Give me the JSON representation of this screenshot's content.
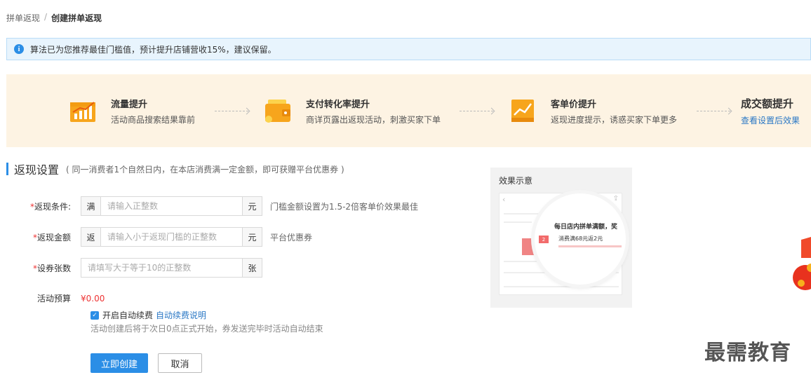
{
  "breadcrumb": {
    "parent": "拼单返现",
    "separator": "/",
    "current": "创建拼单返现"
  },
  "info": {
    "icon": "info-icon",
    "text": "算法已为您推荐最佳门槛值，预计提升店铺营收15%，建议保留。"
  },
  "steps": [
    {
      "icon": "traffic-chart-icon",
      "title": "流量提升",
      "desc": "活动商品搜索结果靠前"
    },
    {
      "icon": "wallet-icon",
      "title": "支付转化率提升",
      "desc": "商详页露出返现活动，刺激买家下单"
    },
    {
      "icon": "price-chart-icon",
      "title": "客单价提升",
      "desc": "返现进度提示，诱惑买家下单更多"
    },
    {
      "title": "成交额提升",
      "link": "查看设置后效果"
    }
  ],
  "section": {
    "title": "返现设置",
    "subtitle": "( 同一消费者1个自然日内，在本店消费满一定金额，即可获赠平台优惠券 )"
  },
  "form": {
    "condition": {
      "required": "*",
      "label": "返现条件:",
      "prefix": "满",
      "placeholder": "请输入正整数",
      "suffix": "元",
      "hint": "门槛金额设置为1.5-2倍客单价效果最佳"
    },
    "amount": {
      "required": "*",
      "label": "返现金额",
      "prefix": "返",
      "placeholder": "请输入小于返现门槛的正整数",
      "suffix": "元",
      "hint": "平台优惠券"
    },
    "count": {
      "required": "*",
      "label": "设券张数",
      "placeholder": "请填写大于等于10的正整数",
      "suffix": "张"
    },
    "budget": {
      "label": "活动预算",
      "value": "¥0.00"
    },
    "auto_renew": {
      "checkbox": "✓",
      "label": "开启自动续费",
      "link": "自动续费说明"
    },
    "note": "活动创建后将于次日0点正式开始，券发送完毕时活动自动结束"
  },
  "buttons": {
    "create": "立即创建",
    "cancel": "取消"
  },
  "preview": {
    "title": "效果示意",
    "bubble_text": "每日店内拼单满额，奖",
    "coupon_badge": "2",
    "coupon_text": "消费满68元返2元"
  },
  "watermark": "最需教育",
  "colors": {
    "primary": "#2b8ee6",
    "required": "#e33333",
    "banner_bg": "#fdf3e3",
    "info_bg": "#e8f4fd"
  }
}
